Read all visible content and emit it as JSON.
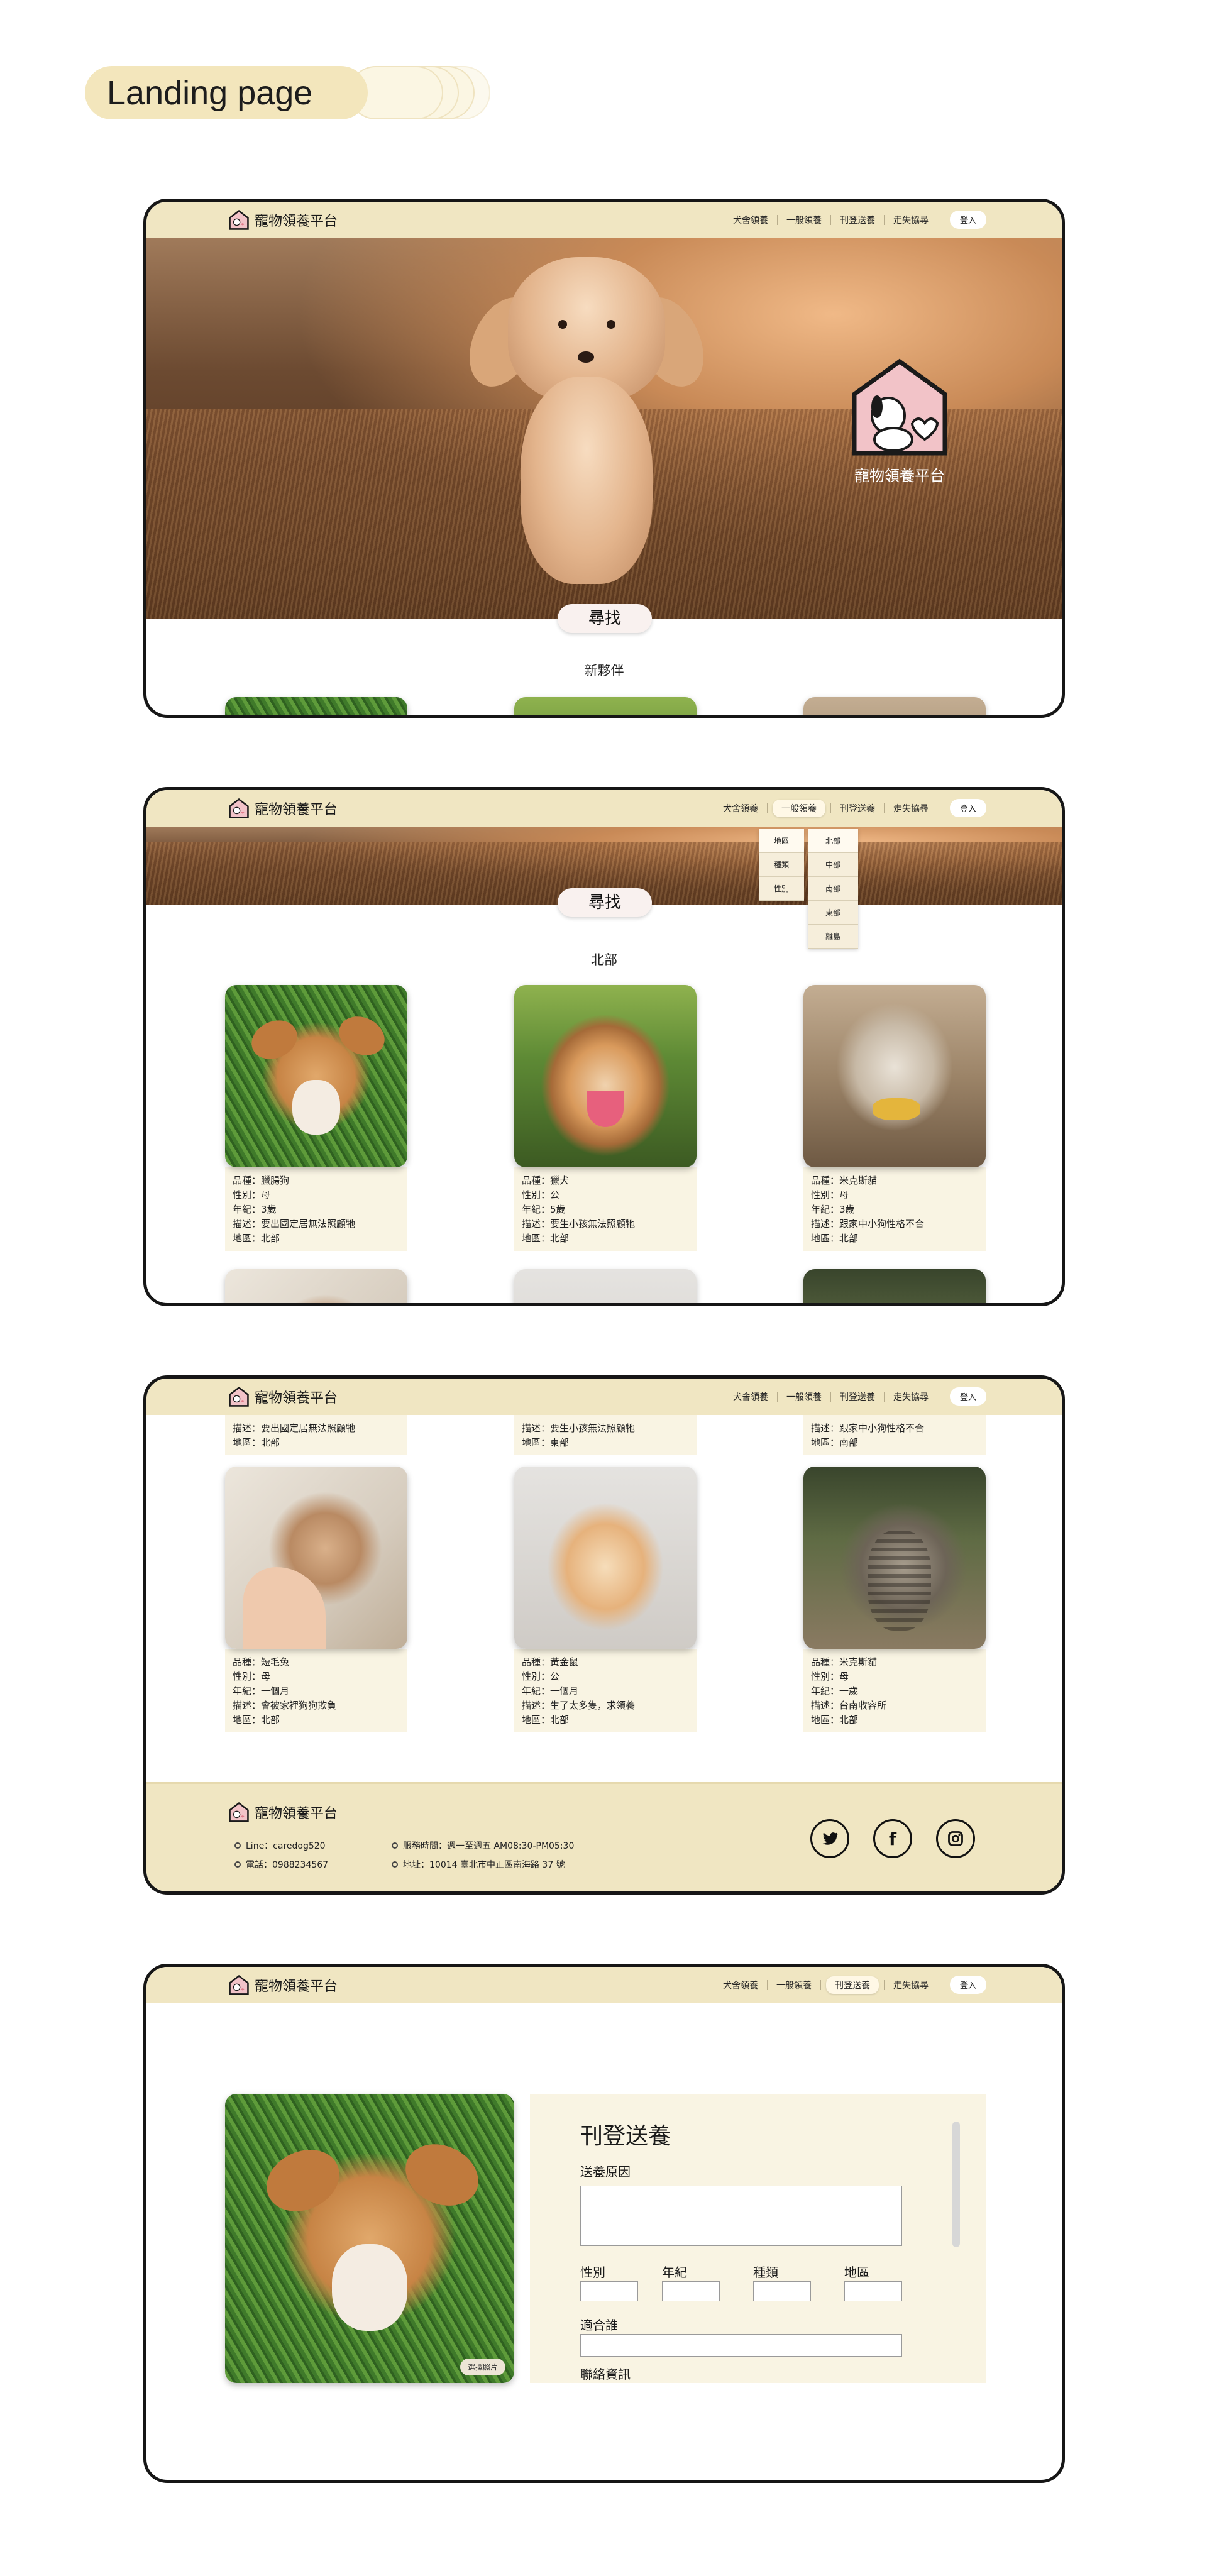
{
  "page_label": "Landing page",
  "brand": "寵物領養平台",
  "nav": {
    "links": [
      "犬舍領養",
      "一般領養",
      "刊登送養",
      "走失協尋"
    ],
    "login": "登入"
  },
  "search_label": "尋找",
  "frame1": {
    "section_title": "新夥伴"
  },
  "frame2": {
    "section_title": "北部",
    "filter_menu": [
      "地區",
      "種類",
      "性別"
    ],
    "region_menu": [
      "北部",
      "中部",
      "南部",
      "東部",
      "離島"
    ],
    "cards": [
      {
        "lines": [
          "品種：臘腸狗",
          "性別：母",
          "年紀：3歲",
          "描述：要出國定居無法照顧牠",
          "地區：北部"
        ]
      },
      {
        "lines": [
          "品種：獵犬",
          "性別：公",
          "年紀：5歲",
          "描述：要生小孩無法照顧牠",
          "地區：北部"
        ]
      },
      {
        "lines": [
          "品種：米克斯貓",
          "性別：母",
          "年紀：3歲",
          "描述：跟家中小狗性格不合",
          "地區：北部"
        ]
      }
    ]
  },
  "frame3": {
    "partial_lines": [
      [
        "描述：要出國定居無法照顧牠",
        "地區：北部"
      ],
      [
        "描述：要生小孩無法照顧牠",
        "地區：東部"
      ],
      [
        "描述：跟家中小狗性格不合",
        "地區：南部"
      ]
    ],
    "cards": [
      {
        "lines": [
          "品種：短毛兔",
          "性別：母",
          "年紀：一個月",
          "描述：會被家裡狗狗欺負",
          "地區：北部"
        ]
      },
      {
        "lines": [
          "品種：黃金鼠",
          "性別：公",
          "年紀：一個月",
          "描述：生了太多隻，求領養",
          "地區：北部"
        ]
      },
      {
        "lines": [
          "品種：米克斯貓",
          "性別：母",
          "年紀：一歲",
          "描述：台南收容所",
          "地區：北部"
        ]
      }
    ],
    "footer": {
      "line": "Line：caredog520",
      "phone": "電話：0988234567",
      "hours": "服務時間：週一至週五 AM08:30-PM05:30",
      "address": "地址：10014 臺北市中正區南海路 37 號",
      "social": [
        "twitter-icon",
        "facebook-icon",
        "instagram-icon"
      ]
    }
  },
  "frame4": {
    "form_title": "刊登送養",
    "labels": {
      "reason": "送養原因",
      "gender": "性別",
      "age": "年紀",
      "species": "種類",
      "region": "地區",
      "suitable": "適合誰",
      "contact": "聯絡資訊"
    },
    "choose_photo": "選擇照片"
  },
  "colors": {
    "nav_bg": "#f0e6c2",
    "card_info_bg": "#f9f4e3",
    "frame_border": "#161616",
    "logo_pink": "#f2c3c8"
  }
}
